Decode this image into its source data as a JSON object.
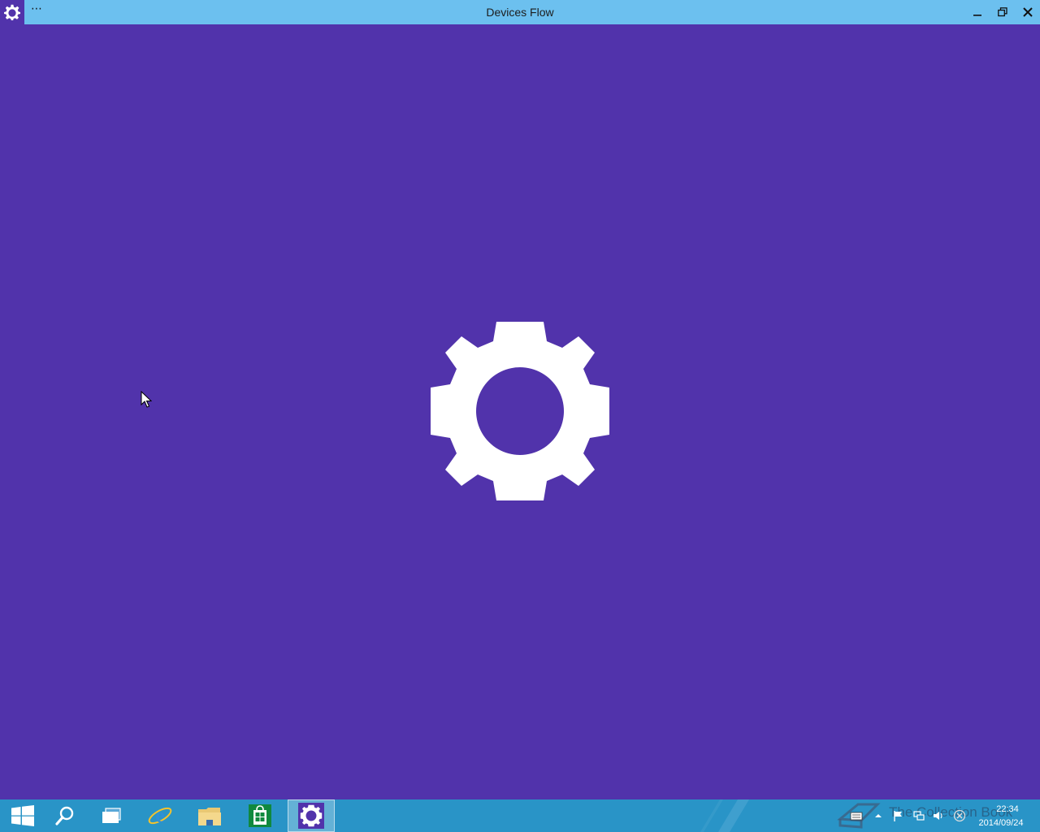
{
  "window": {
    "title": "Devices Flow",
    "menu_label": "⋯",
    "app_icon": "gear-icon",
    "controls": [
      "minimize-icon",
      "restore-icon",
      "close-icon"
    ]
  },
  "content": {
    "background": "#5133ab",
    "splash_icon": "gear-icon",
    "splash_color": "#ffffff"
  },
  "taskbar": {
    "background": "#2994c7",
    "items": [
      {
        "name": "start",
        "icon": "windows-logo-icon"
      },
      {
        "name": "search",
        "icon": "search-icon"
      },
      {
        "name": "task-view",
        "icon": "task-view-icon"
      },
      {
        "name": "internet-explorer",
        "icon": "internet-explorer-icon"
      },
      {
        "name": "file-explorer",
        "icon": "folder-icon"
      },
      {
        "name": "store",
        "icon": "store-icon"
      },
      {
        "name": "settings",
        "icon": "gear-icon",
        "active": true
      }
    ],
    "tray": {
      "watermark": "The Collection Book",
      "icons": [
        "keyboard-icon",
        "chevron-up-icon",
        "flag-icon",
        "network-icon",
        "volume-icon",
        "error-icon"
      ],
      "time": "22:34",
      "date": "2014/09/24"
    }
  },
  "colors": {
    "titlebar": "#6cc0ef",
    "accent": "#5133ab",
    "taskbar": "#2994c7"
  }
}
